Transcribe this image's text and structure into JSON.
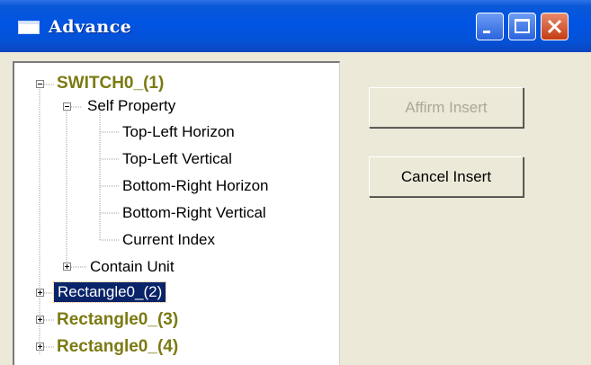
{
  "window": {
    "title": "Advance"
  },
  "tree": {
    "nodes": [
      {
        "label": "SWITCH0_(1)"
      },
      {
        "label": "Self Property"
      },
      {
        "label": "Top-Left Horizon"
      },
      {
        "label": "Top-Left Vertical"
      },
      {
        "label": "Bottom-Right Horizon"
      },
      {
        "label": "Bottom-Right Vertical"
      },
      {
        "label": "Current Index"
      },
      {
        "label": "Contain Unit"
      },
      {
        "label": "Rectangle0_(2)"
      },
      {
        "label": "Rectangle0_(3)"
      },
      {
        "label": "Rectangle0_(4)"
      }
    ]
  },
  "buttons": {
    "affirm_insert": "Affirm Insert",
    "cancel_insert": "Cancel Insert"
  },
  "colors": {
    "titlebar": "#0054e3",
    "root_node_text": "#7b7a12",
    "selection": "#0a246a"
  }
}
